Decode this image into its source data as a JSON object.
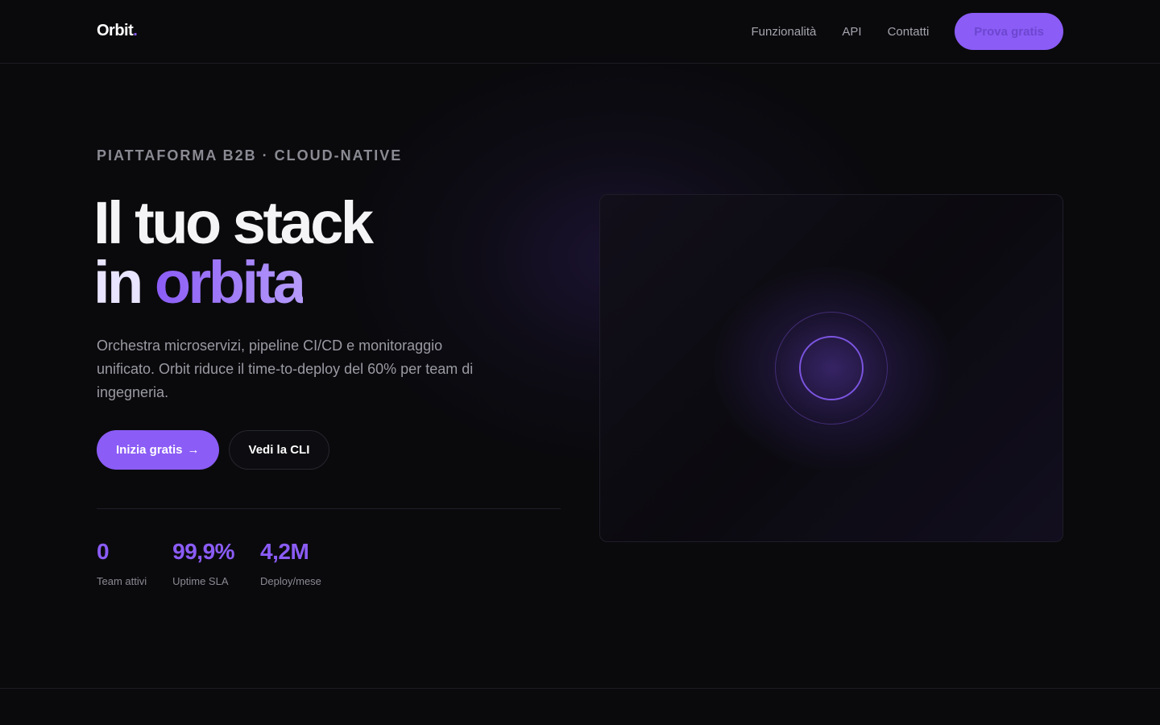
{
  "header": {
    "logo_text": "Orbit",
    "logo_dot": ".",
    "nav": [
      {
        "label": "Funzionalità"
      },
      {
        "label": "API"
      },
      {
        "label": "Contatti"
      }
    ],
    "cta_label": "Prova gratis"
  },
  "hero": {
    "eyebrow": "PIATTAFORMA B2B · CLOUD-NATIVE",
    "headline_line1": "Il tuo stack",
    "headline_line2_a": "in ",
    "headline_line2_b": "orbita",
    "lead": "Orchestra microservizi, pipeline CI/CD e monitoraggio unificato. Orbit riduce il time-to-deploy del 60% per team di ingegneria.",
    "primary_button": "Inizia gratis",
    "primary_button_arrow": "→",
    "secondary_button": "Vedi la CLI"
  },
  "stats": [
    {
      "value": "0",
      "label": "Team attivi"
    },
    {
      "value": "99,9%",
      "label": "Uptime SLA"
    },
    {
      "value": "4,2M",
      "label": "Deploy/mese"
    }
  ],
  "colors": {
    "accent": "#8b5cf6",
    "background": "#0a0a0d"
  },
  "icons": {
    "arrow": "arrow-right-icon",
    "orbit_visual": "orbit-rings-icon"
  }
}
